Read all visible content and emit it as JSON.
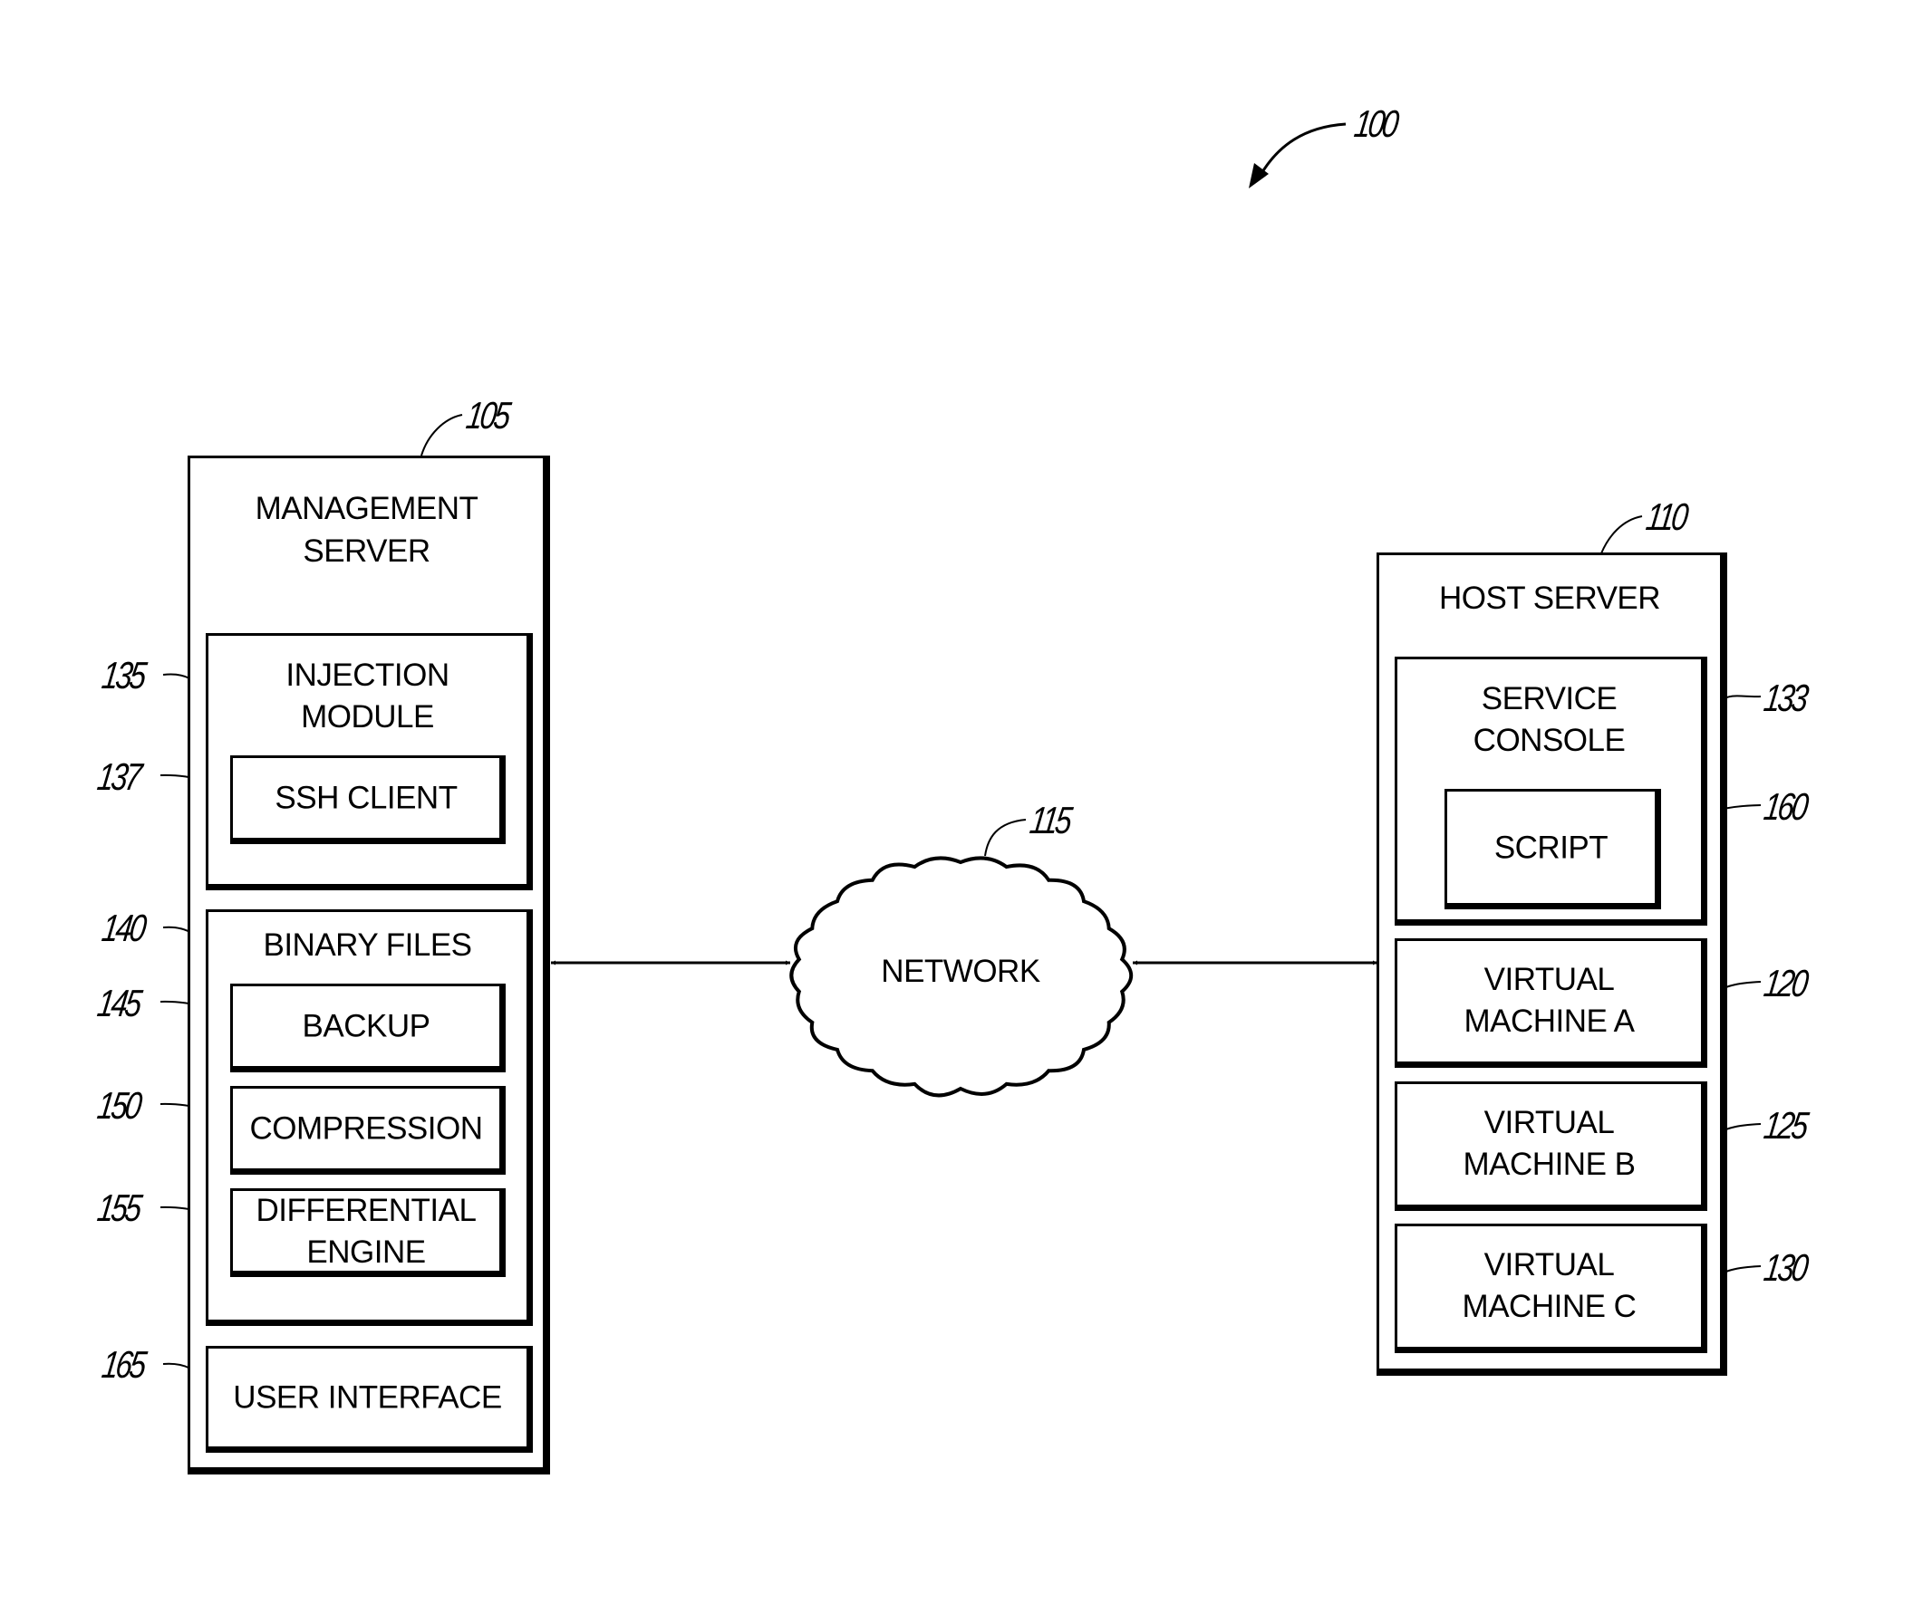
{
  "figure": {
    "ref": "100"
  },
  "management_server": {
    "ref": "105",
    "title_line1": "MANAGEMENT",
    "title_line2": "SERVER",
    "injection_module": {
      "ref": "135",
      "title_line1": "INJECTION",
      "title_line2": "MODULE",
      "ssh_client": {
        "ref": "137",
        "label": "SSH CLIENT"
      }
    },
    "binary_files": {
      "ref": "140",
      "title": "BINARY FILES",
      "backup": {
        "ref": "145",
        "label": "BACKUP"
      },
      "compression": {
        "ref": "150",
        "label": "COMPRESSION"
      },
      "differential_engine": {
        "ref": "155",
        "label_line1": "DIFFERENTIAL",
        "label_line2": "ENGINE"
      }
    },
    "user_interface": {
      "ref": "165",
      "label": "USER INTERFACE"
    }
  },
  "network": {
    "ref": "115",
    "label": "NETWORK"
  },
  "host_server": {
    "ref": "110",
    "title": "HOST SERVER",
    "service_console": {
      "ref": "133",
      "title_line1": "SERVICE",
      "title_line2": "CONSOLE",
      "script": {
        "ref": "160",
        "label": "SCRIPT"
      }
    },
    "vm_a": {
      "ref": "120",
      "label_line1": "VIRTUAL",
      "label_line2": "MACHINE A"
    },
    "vm_b": {
      "ref": "125",
      "label_line1": "VIRTUAL",
      "label_line2": "MACHINE B"
    },
    "vm_c": {
      "ref": "130",
      "label_line1": "VIRTUAL",
      "label_line2": "MACHINE C"
    }
  }
}
